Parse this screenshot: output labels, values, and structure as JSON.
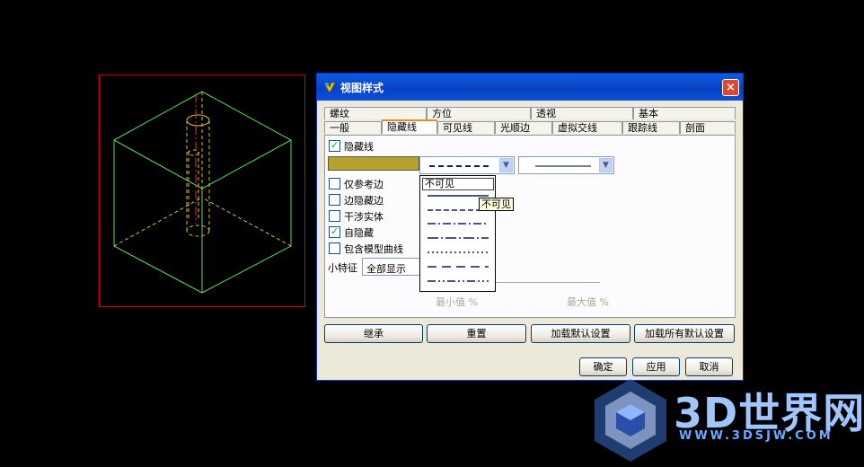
{
  "dialog": {
    "title": "视图样式",
    "close": "×"
  },
  "tabs_top": [
    "螺纹",
    "方位",
    "透视",
    "基本"
  ],
  "tabs_bottom": [
    "一般",
    "隐藏线",
    "可见线",
    "光顺边",
    "虚拟交线",
    "跟踪线",
    "剖面"
  ],
  "active_tab": "隐藏线",
  "hidden_lines": {
    "checkbox_label": "隐藏线",
    "checked": true,
    "color": "#b6a12d",
    "options": [
      {
        "label": "仅参考边",
        "checked": false
      },
      {
        "label": "边隐藏边",
        "checked": false
      },
      {
        "label": "干涉实体",
        "checked": false
      },
      {
        "label": "自隐藏",
        "checked": true
      },
      {
        "label": "包含模型曲线",
        "checked": false
      }
    ],
    "small_feature_label": "小特征",
    "small_feature_value": "全部显示",
    "linetype_dropdown_selected": "不可见",
    "tooltip": "不可见",
    "min_label": "最小值",
    "max_label": "最大值",
    "percent": "%"
  },
  "buttons": {
    "inherit": "继承",
    "reset": "重置",
    "load_default": "加载默认设置",
    "load_all_default": "加载所有默认设置",
    "ok": "确定",
    "apply": "应用",
    "cancel": "取消"
  },
  "watermark": {
    "text": "3D世界网",
    "url": "WWW.3DSJW.COM"
  }
}
